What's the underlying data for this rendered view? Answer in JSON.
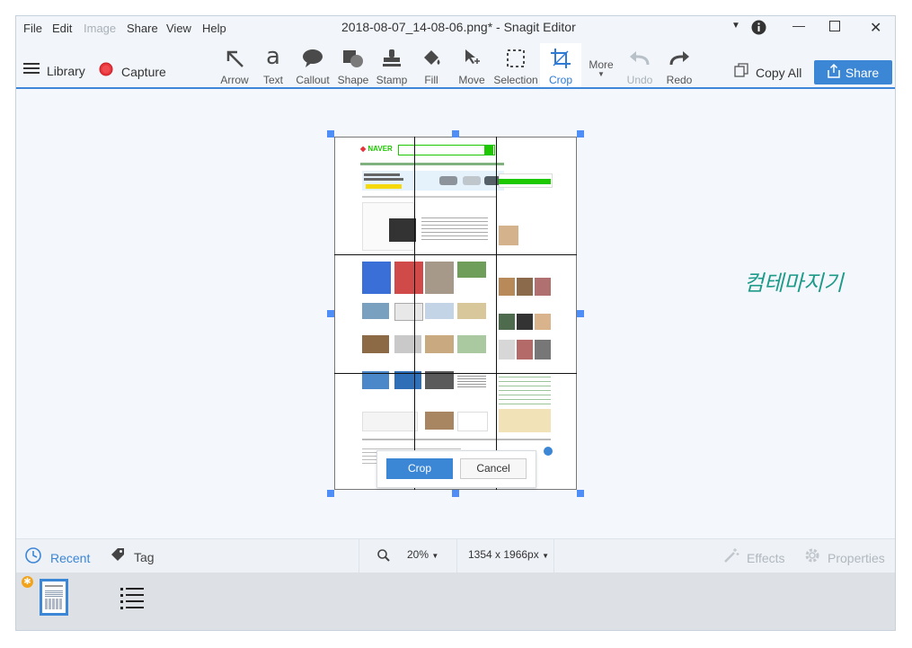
{
  "menu": {
    "file": "File",
    "edit": "Edit",
    "image": "Image",
    "share": "Share",
    "view": "View",
    "help": "Help"
  },
  "window_title": "2018-08-07_14-08-06.png* - Snagit Editor",
  "toolbar": {
    "library": "Library",
    "capture": "Capture",
    "tools": [
      {
        "label": "Arrow",
        "icon": "arrow-icon"
      },
      {
        "label": "Text",
        "icon": "text-icon"
      },
      {
        "label": "Callout",
        "icon": "callout-icon"
      },
      {
        "label": "Shape",
        "icon": "shape-icon"
      },
      {
        "label": "Stamp",
        "icon": "stamp-icon"
      },
      {
        "label": "Fill",
        "icon": "fill-icon"
      },
      {
        "label": "Move",
        "icon": "move-icon"
      },
      {
        "label": "Selection",
        "icon": "selection-icon"
      },
      {
        "label": "Crop",
        "icon": "crop-icon"
      }
    ],
    "more": "More",
    "undo": "Undo",
    "redo": "Redo",
    "copy_all": "Copy All",
    "share": "Share"
  },
  "canvas": {
    "watermark": "컴테마지기",
    "crop_button": "Crop",
    "cancel_button": "Cancel",
    "doc_brand": "NAVER"
  },
  "bottombar": {
    "recent": "Recent",
    "tag": "Tag",
    "zoom": "20%",
    "dimensions": "1354 x 1966px",
    "effects": "Effects",
    "properties": "Properties"
  },
  "colors": {
    "accent": "#3c86d6",
    "capture_red": "#e8333a",
    "naver_green": "#1ec800"
  }
}
